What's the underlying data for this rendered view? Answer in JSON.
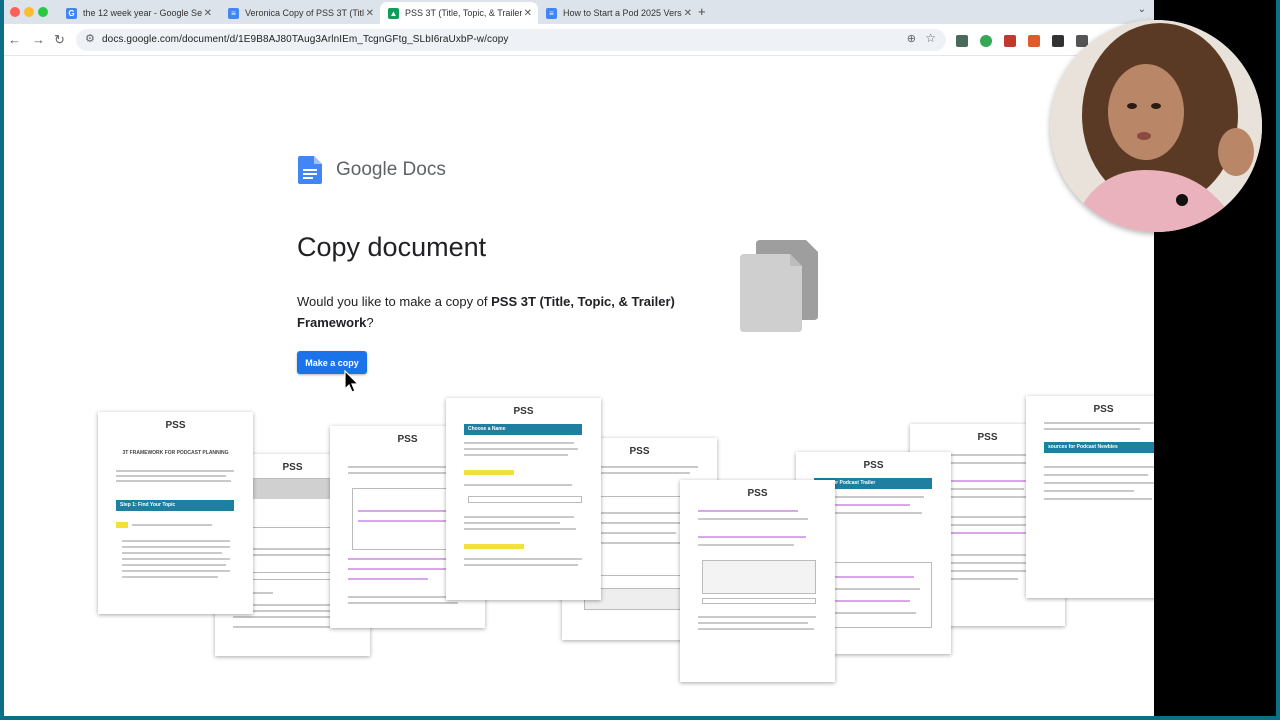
{
  "browser": {
    "tabs": [
      {
        "title": "the 12 week year - Google Se",
        "icon": "google-icon",
        "color": "#4285f4"
      },
      {
        "title": "Veronica Copy of PSS 3T (Titl",
        "icon": "docs-icon",
        "color": "#4285f4"
      },
      {
        "title": "PSS 3T (Title, Topic, & Trailer",
        "icon": "drive-icon",
        "color": "#0f9d58"
      },
      {
        "title": "How to Start a Pod 2025 Vers",
        "icon": "docs-icon",
        "color": "#4285f4"
      }
    ],
    "url": "docs.google.com/document/d/1E9B8AJ80TAug3ArlnIEm_TcgnGFtg_SLbI6raUxbP-w/copy"
  },
  "dialog": {
    "brand": "Google Docs",
    "title": "Copy document",
    "prompt_prefix": "Would you like to make a copy of ",
    "doc_name": "PSS 3T (Title, Topic, & Trailer) Framework",
    "prompt_suffix": "?",
    "button_label": "Make a copy"
  },
  "pages": {
    "logo": "PSS",
    "p1_heading": "3T FRAMEWORK FOR PODCAST PLANNING",
    "p1_step": "Step 1: Find Your Topic",
    "p4_step": "Choose a Name",
    "p7_step": "rite Your Podcast Trailer",
    "p9_step": "sources for Podcast Newbies"
  },
  "colors": {
    "accent": "#1a73e8",
    "teal": "#1f7fa0",
    "frame": "#0d6e88"
  }
}
